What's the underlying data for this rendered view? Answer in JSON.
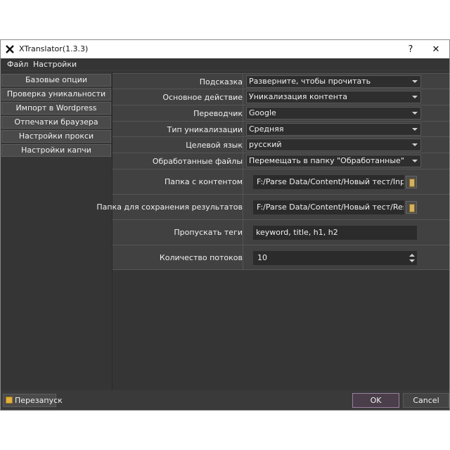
{
  "window": {
    "title": "XTranslator(1.3.3)",
    "help_glyph": "?",
    "close_glyph": "✕",
    "app_icon": "x-logo-icon"
  },
  "menu": [
    "Файл",
    "Настройки"
  ],
  "sidebar": {
    "items": [
      {
        "label": "Базовые опции"
      },
      {
        "label": "Проверка уникальности"
      },
      {
        "label": "Импорт в Wordpress"
      },
      {
        "label": "Отпечатки браузера"
      },
      {
        "label": "Настройки прокси"
      },
      {
        "label": "Настройки капчи"
      }
    ]
  },
  "settings": {
    "hint": {
      "label": "Подсказка",
      "value": "Разверните, чтобы прочитать"
    },
    "main_action": {
      "label": "Основное действие",
      "value": "Уникализация контента"
    },
    "translator": {
      "label": "Переводчик",
      "value": "Google"
    },
    "uniq_type": {
      "label": "Тип уникализации",
      "value": "Средняя"
    },
    "target_lang": {
      "label": "Целевой язык",
      "value": "русский"
    },
    "processed_files": {
      "label": "Обработанные файлы",
      "value": "Перемещать в папку \"Обработанные\""
    },
    "content_folder": {
      "label": "Папка с контентом",
      "value": "F:/Parse Data/Content/Новый тест/Input"
    },
    "results_folder": {
      "label": "Папка для сохранения результатов",
      "value": "F:/Parse Data/Content/Новый тест/Results"
    },
    "skip_tags": {
      "label": "Пропускать теги",
      "value": "keyword, title, h1, h2"
    },
    "threads": {
      "label": "Количество потоков",
      "value": "10"
    }
  },
  "footer": {
    "restart_label": "Перезапуск",
    "ok_label": "OK",
    "cancel_label": "Cancel"
  },
  "colors": {
    "background": "#3c3c3c",
    "panel": "#414141",
    "field": "#2b2b2b",
    "ok_border": "#9b7fa1"
  }
}
